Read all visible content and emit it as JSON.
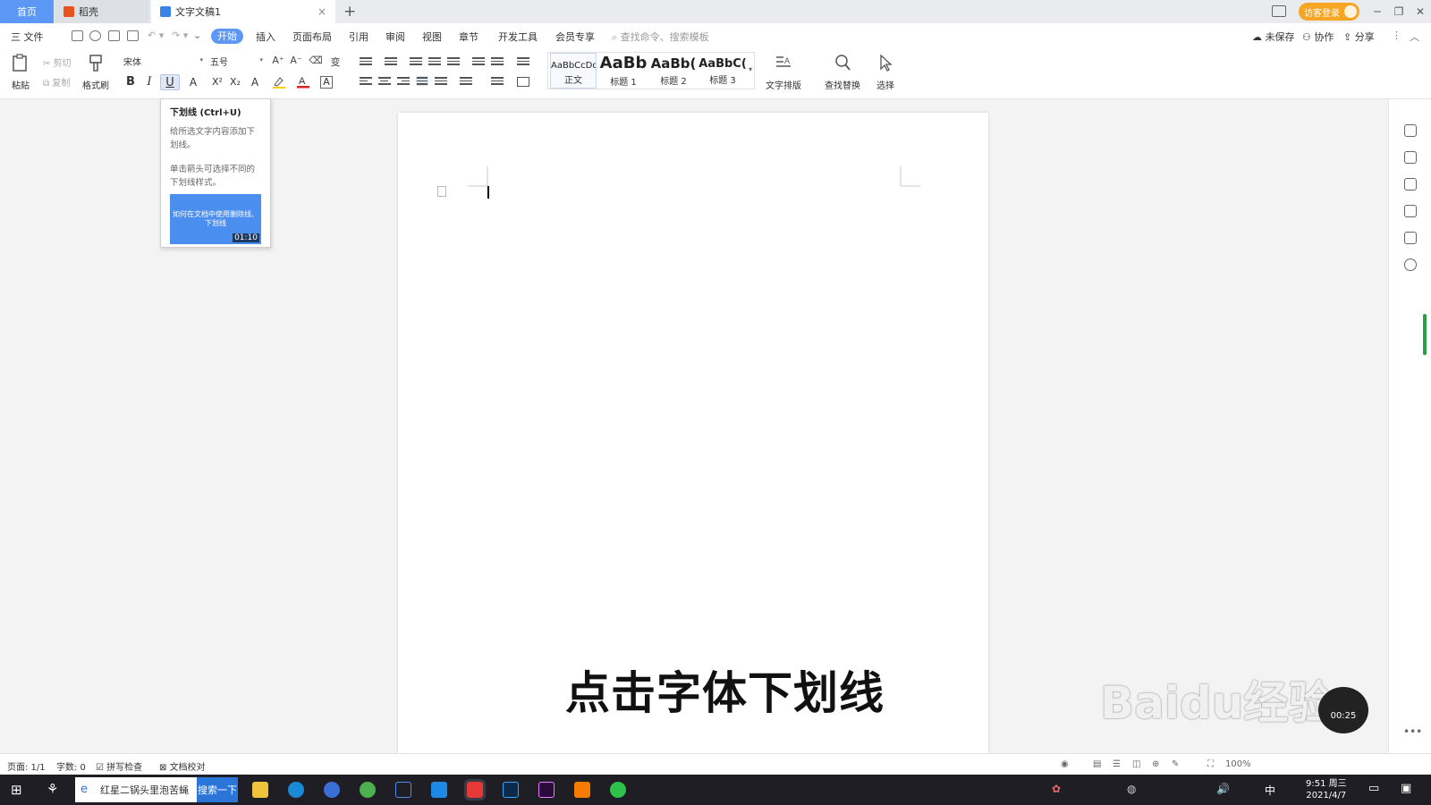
{
  "tabs": {
    "home": "首页",
    "daoke": "稻壳",
    "document": "文字文稿1",
    "add": "+",
    "close": "×"
  },
  "titlebar": {
    "guest_login": "访客登录"
  },
  "menu": {
    "file": "三 文件",
    "items": [
      "开始",
      "插入",
      "页面布局",
      "引用",
      "审阅",
      "视图",
      "章节",
      "开发工具",
      "会员专享"
    ],
    "search_placeholder": "查找命令、搜索模板",
    "unsaved": "未保存",
    "collaborate": "协作",
    "share": "分享"
  },
  "ribbon": {
    "paste": "粘贴",
    "cut": "剪切",
    "copy": "复制",
    "format_painter": "格式刷",
    "font_name": "宋体",
    "font_size": "五号",
    "styles": [
      {
        "preview": "AaBbCcDd",
        "name": "正文"
      },
      {
        "preview": "AaBb",
        "name": "标题 1"
      },
      {
        "preview": "AaBb(",
        "name": "标题 2"
      },
      {
        "preview": "AaBbC(",
        "name": "标题 3"
      }
    ],
    "text_layout": "文字排版",
    "find_replace": "查找替换",
    "select": "选择"
  },
  "tooltip": {
    "title": "下划线 (Ctrl+U)",
    "desc1": "给所选文字内容添加下划线。",
    "desc2": "单击箭头可选择不同的下划线样式。",
    "video_caption": "如何在文档中使用删除线、下划线",
    "video_duration": "01:10"
  },
  "overlay": {
    "subtitle": "点击字体下划线",
    "watermark": "Baidu经验",
    "video_time": "00:25"
  },
  "statusbar": {
    "page": "页面: 1/1",
    "words": "字数: 0",
    "spellcheck": "拼写检查",
    "proofread": "文档校对",
    "zoom": "100%"
  },
  "taskbar": {
    "search_text": "红星二锅头里泡苦蝇",
    "search_button": "搜索一下",
    "ime": "中",
    "time": "9:51 周三",
    "date": "2021/4/7"
  },
  "colors": {
    "accent": "#5c97f5",
    "guest": "#f6a623",
    "taskbar": "#1e1e24"
  }
}
